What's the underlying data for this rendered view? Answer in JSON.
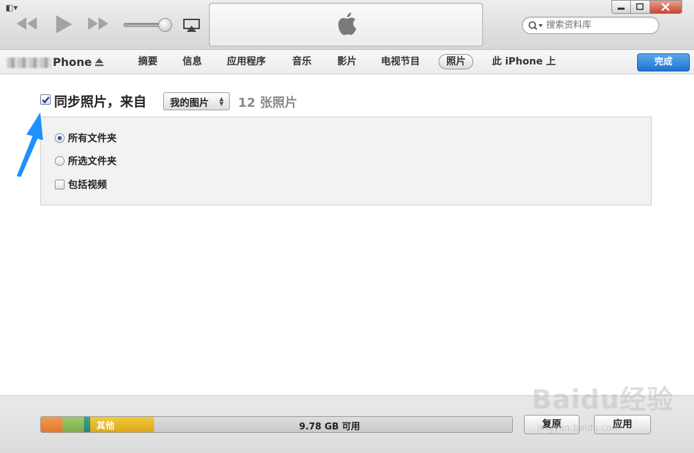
{
  "player": {
    "search_placeholder": "搜索资料库"
  },
  "device": {
    "name": "Phone"
  },
  "tabs": [
    {
      "label": "摘要"
    },
    {
      "label": "信息"
    },
    {
      "label": "应用程序"
    },
    {
      "label": "音乐"
    },
    {
      "label": "影片"
    },
    {
      "label": "电视节目"
    },
    {
      "label": "照片",
      "active": true
    },
    {
      "label": "此 iPhone 上"
    }
  ],
  "done_label": "完成",
  "sync": {
    "checked": true,
    "label": "同步照片，来自",
    "source": "我的图片",
    "count": "12 张照片"
  },
  "options": [
    {
      "type": "radio",
      "label": "所有文件夹",
      "checked": true
    },
    {
      "type": "radio",
      "label": "所选文件夹",
      "checked": false
    },
    {
      "type": "checkbox",
      "label": "包括视频",
      "checked": false
    }
  ],
  "storage": {
    "other_label": "其他",
    "free_label": "9.78 GB 可用"
  },
  "buttons": {
    "restore": "复原",
    "apply": "应用"
  },
  "watermark": {
    "text": "Baidu经验",
    "sub": "jingyan.baidu.com"
  },
  "colors": {
    "accent_blue": "#1f73cf",
    "arrow_blue": "#1e90ff",
    "storage_orange": "#e1782d",
    "storage_green": "#7aac4b",
    "storage_teal": "#2b8572",
    "storage_yellow": "#dca51b"
  }
}
